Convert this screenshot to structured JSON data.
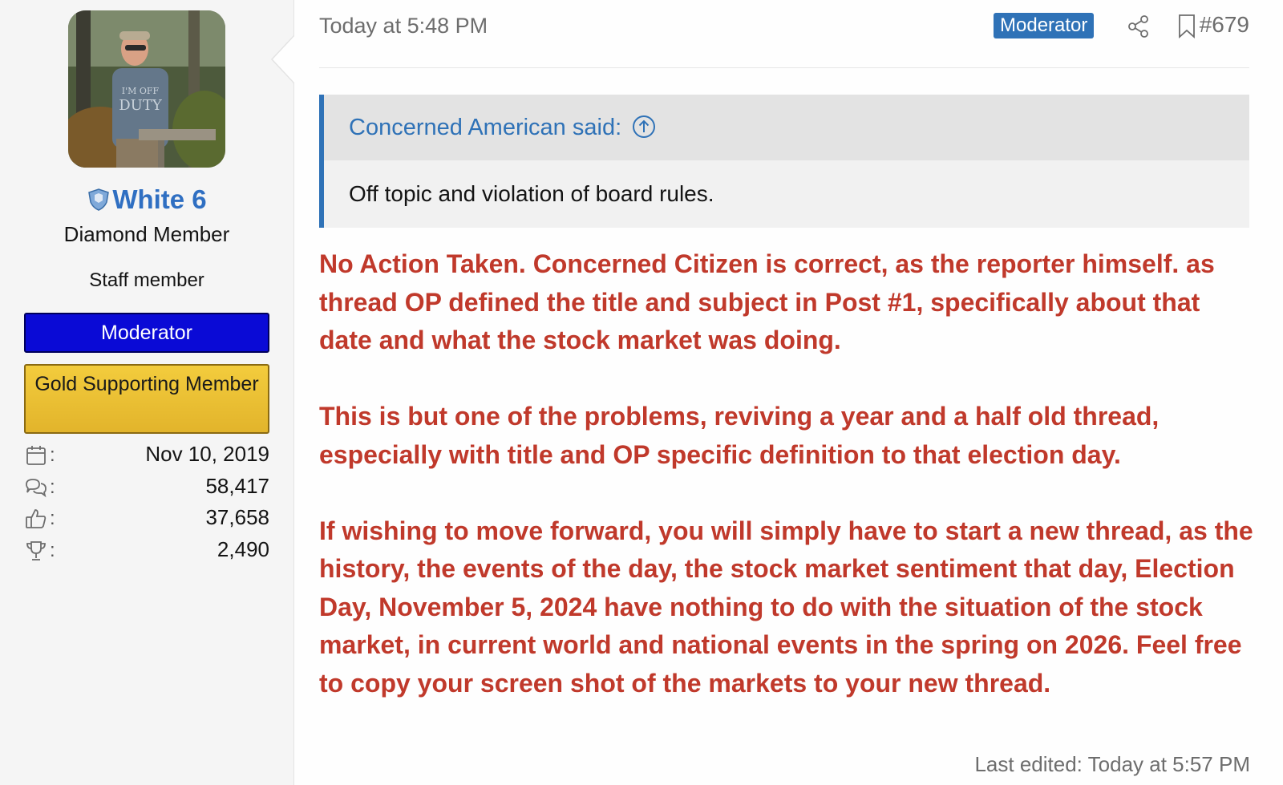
{
  "user": {
    "avatar": "photo-avatar",
    "username": "White 6",
    "title": "Diamond Member",
    "staff_label": "Staff member",
    "banners": [
      "Moderator",
      "Gold Supporting Member"
    ],
    "stats": [
      {
        "icon": "calendar-icon",
        "value": "Nov 10, 2019"
      },
      {
        "icon": "messages-icon",
        "value": "58,417"
      },
      {
        "icon": "thumbs-up-icon",
        "value": "37,658"
      },
      {
        "icon": "trophy-icon",
        "value": "2,490"
      }
    ]
  },
  "post": {
    "date": "Today at 5:48 PM",
    "badge": "Moderator",
    "number": "#679",
    "quote": {
      "author_label": "Concerned American said:",
      "text": "Off topic and violation of board rules."
    },
    "paragraphs": [
      "No Action Taken. Concerned Citizen is correct, as the reporter himself. as thread OP defined the title and subject in Post #1, specifically about that date and what the stock market was doing.",
      "This is but one of the problems, reviving a year and a half old thread, especially with title and OP specific definition to that election day.",
      "If wishing to move forward, you will simply have to start a new thread, as the history, the events of the day, the stock market sentiment that day, Election Day, November 5, 2024 have nothing to do with the situation of the stock market, in current world and national events in the spring on 2026. Feel free to copy your screen shot of the markets to your new thread."
    ],
    "last_edited": "Last edited: Today at 5:57 PM"
  },
  "colors": {
    "accent": "#2f72b7",
    "username": "#2f6fc2",
    "message": "#c0392b",
    "moderator_banner": "#0a0ad6",
    "gold_banner": "#e8bd31"
  }
}
